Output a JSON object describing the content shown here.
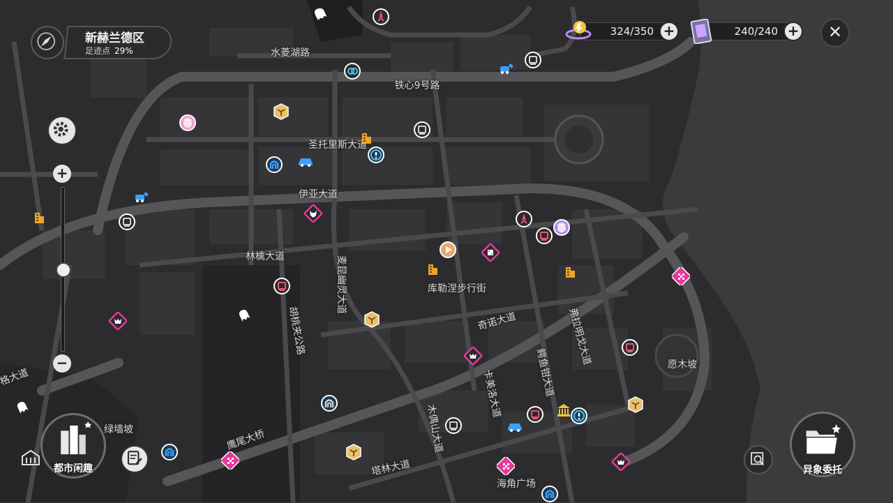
{
  "district": {
    "name": "新赫兰德区",
    "footprint_label": "足迹点",
    "footprint_value": "29%"
  },
  "resources": [
    {
      "name": "battery-charge",
      "value": "324/350"
    },
    {
      "name": "card",
      "value": "240/240"
    }
  ],
  "close_label": "✕",
  "zoom": {
    "in_label": "+",
    "out_label": "−",
    "level": 0.5
  },
  "buttons": {
    "city_fun": "都市闲趣",
    "commission": "异象委托"
  },
  "streets": [
    {
      "text": "水菱湖路"
    },
    {
      "text": "铁心9号路"
    },
    {
      "text": "圣托里斯大道"
    },
    {
      "text": "伊亚大道"
    },
    {
      "text": "林檎大道"
    },
    {
      "text": "麦昆幽灵大道"
    },
    {
      "text": "胡桃夹公路"
    },
    {
      "text": "库勒涅步行街"
    },
    {
      "text": "奇诺大道"
    },
    {
      "text": "弗拉明戈大道"
    },
    {
      "text": "愿木坡"
    },
    {
      "text": "鳄鱼钳大道"
    },
    {
      "text": "卡美洛大道"
    },
    {
      "text": "木偶山大道"
    },
    {
      "text": "绿墙坡"
    },
    {
      "text": "塔林大道"
    },
    {
      "text": "海角广场"
    },
    {
      "text": "鹰尾大桥"
    },
    {
      "text": "格大道"
    }
  ],
  "markers": [
    {
      "type": "ghost-icon",
      "color": "#ffffff"
    },
    {
      "type": "rocket-icon",
      "color": "#e8566f"
    },
    {
      "type": "wrench-car-icon",
      "color": "#3aa0ff"
    },
    {
      "type": "tv-icon",
      "color": "#d0d0d0"
    },
    {
      "type": "ring-icon",
      "color": "#49c6f0"
    },
    {
      "type": "box-icon",
      "color": "#e9c06a"
    },
    {
      "type": "character-icon",
      "color": "#f29bd4"
    },
    {
      "type": "tv-icon",
      "color": "#d0d0d0"
    },
    {
      "type": "building-icon",
      "color": "#f0a329"
    },
    {
      "type": "arch-icon",
      "color": "#3aa0ff"
    },
    {
      "type": "car-icon",
      "color": "#3aa0ff"
    },
    {
      "type": "exclaim-icon",
      "color": "#49c6f0"
    },
    {
      "type": "wrench-car-icon",
      "color": "#3aa0ff"
    },
    {
      "type": "building-icon",
      "color": "#f0a329"
    },
    {
      "type": "tv-icon",
      "color": "#d0d0d0"
    },
    {
      "type": "fox-icon",
      "color": "#e13a9a"
    },
    {
      "type": "rocket-icon",
      "color": "#e8566f"
    },
    {
      "type": "character-icon",
      "color": "#b18cf0"
    },
    {
      "type": "play-icon",
      "color": "#e9a86a"
    },
    {
      "type": "dice-icon",
      "color": "#e13a9a"
    },
    {
      "type": "building-icon",
      "color": "#f0a329"
    },
    {
      "type": "building-icon",
      "color": "#f0a329"
    },
    {
      "type": "checker-flag-icon",
      "color": "#e13a9a"
    },
    {
      "type": "tv-icon",
      "color": "#e8566f"
    },
    {
      "type": "monster-icon",
      "color": "#e13a9a"
    },
    {
      "type": "ghost-icon",
      "color": "#ffffff"
    },
    {
      "type": "box-icon",
      "color": "#e9c06a"
    },
    {
      "type": "monster-icon",
      "color": "#e13a9a"
    },
    {
      "type": "tv-icon",
      "color": "#e8566f"
    },
    {
      "type": "ghost-icon",
      "color": "#ffffff"
    },
    {
      "type": "arch-icon",
      "color": "#d0d0d0"
    },
    {
      "type": "tv-icon",
      "color": "#d0d0d0"
    },
    {
      "type": "tv-icon",
      "color": "#e8566f"
    },
    {
      "type": "bank-icon",
      "color": "#f0c040"
    },
    {
      "type": "exclaim-icon",
      "color": "#49c6f0"
    },
    {
      "type": "car-icon",
      "color": "#3aa0ff"
    },
    {
      "type": "box-icon",
      "color": "#e9c06a"
    },
    {
      "type": "arch-icon",
      "color": "#3aa0ff"
    },
    {
      "type": "checker-flag-icon",
      "color": "#e13a9a"
    },
    {
      "type": "box-icon",
      "color": "#e9c06a"
    },
    {
      "type": "checker-flag-icon",
      "color": "#e13a9a"
    },
    {
      "type": "monster-icon",
      "color": "#e13a9a"
    },
    {
      "type": "arch-icon",
      "color": "#3aa0ff"
    },
    {
      "type": "ghost-icon",
      "color": "#ffffff"
    },
    {
      "type": "tv-icon",
      "color": "#e8566f"
    }
  ]
}
